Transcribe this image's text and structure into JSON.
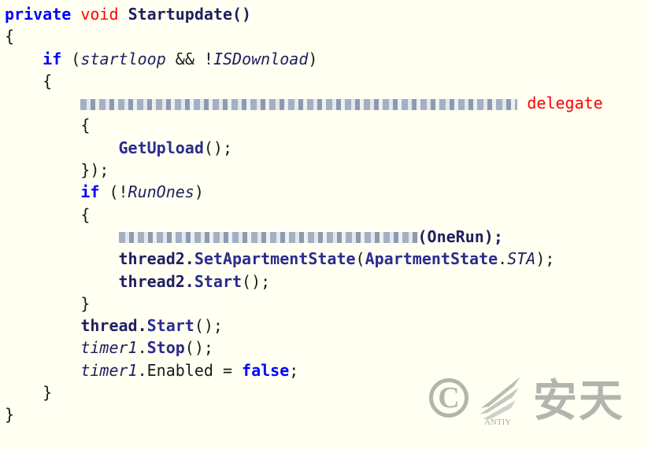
{
  "code": {
    "l1_private": "private",
    "l1_void": "void",
    "l1_name": "Startupdate()",
    "l2": "{",
    "l3_if": "if",
    "l3_open": " (",
    "l3_var1": "startloop",
    "l3_and": " && !",
    "l3_var2": "ISDownload",
    "l3_close": ")",
    "l4": "{",
    "l5_delegate": "delegate",
    "l6": "{",
    "l7_call": "GetUpload",
    "l7_rest": "();",
    "l8": "});",
    "l9_if": "if",
    "l9_open": " (!",
    "l9_var": "RunOnes",
    "l9_close": ")",
    "l10": "{",
    "l11_arg": "(OneRun);",
    "l12_obj": "thread2.",
    "l12_meth": "SetApartmentState",
    "l12_open": "(",
    "l12_type": "ApartmentState",
    "l12_dot": ".",
    "l12_sta": "STA",
    "l12_close": ");",
    "l13_obj": "thread2.",
    "l13_meth": "Start",
    "l13_rest": "();",
    "l14": "}",
    "l15_obj": "thread.",
    "l15_meth": "Start",
    "l15_rest": "();",
    "l16_obj": "timer1",
    "l16_dot": ".",
    "l16_meth": "Stop",
    "l16_rest": "();",
    "l17_obj": "timer1",
    "l17_prop": ".Enabled = ",
    "l17_val": "false",
    "l17_semi": ";",
    "l18": "}",
    "l19": "}"
  },
  "watermark": {
    "copyright": "C",
    "brand_cn": "安天",
    "brand_en": "ANTIY"
  },
  "colors": {
    "keyword": "#0000ff",
    "delegate": "#ff0000",
    "background": "#fffff2"
  }
}
